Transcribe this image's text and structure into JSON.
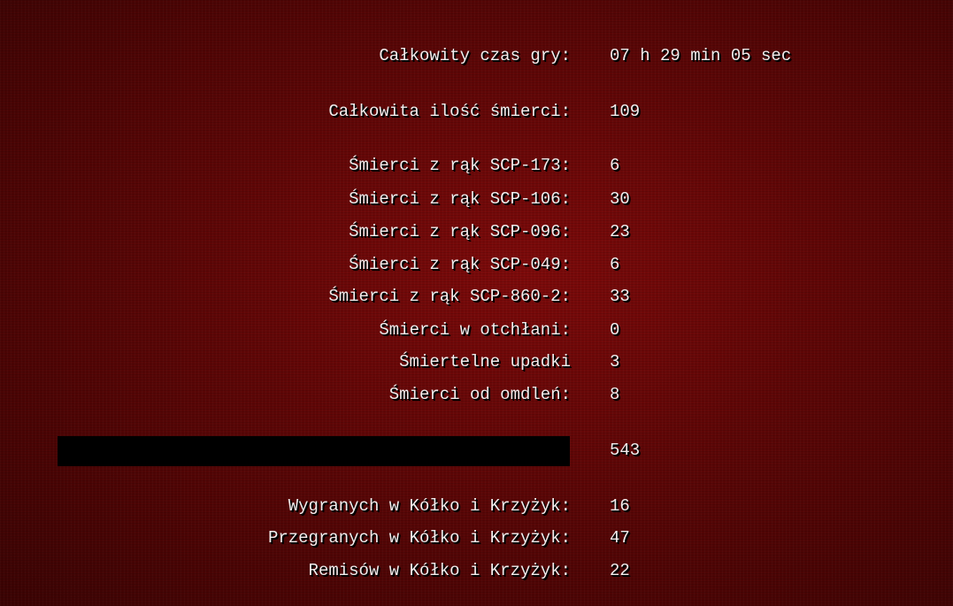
{
  "stats": {
    "total_time": {
      "label": "Całkowity czas gry:",
      "value": "07 h 29 min 05 sec"
    },
    "total_deaths": {
      "label": "Całkowita ilość śmierci:",
      "value": "109"
    },
    "deaths_173": {
      "label": "Śmierci z rąk SCP-173:",
      "value": "6"
    },
    "deaths_106": {
      "label": "Śmierci z rąk SCP-106:",
      "value": "30"
    },
    "deaths_096": {
      "label": "Śmierci z rąk SCP-096:",
      "value": "23"
    },
    "deaths_049": {
      "label": "Śmierci z rąk SCP-049:",
      "value": "6"
    },
    "deaths_860_2": {
      "label": "Śmierci z rąk SCP-860-2:",
      "value": "33"
    },
    "deaths_abyss": {
      "label": "Śmierci w otchłani:",
      "value": "0"
    },
    "fatal_falls": {
      "label": "Śmiertelne upadki",
      "value": "3"
    },
    "faint_deaths": {
      "label": "Śmierci od omdleń:",
      "value": "8"
    },
    "redacted": {
      "value": "543"
    },
    "ttt_wins": {
      "label": "Wygranych w Kółko i Krzyżyk:",
      "value": "16"
    },
    "ttt_losses": {
      "label": "Przegranych w Kółko i Krzyżyk:",
      "value": "47"
    },
    "ttt_draws": {
      "label": "Remisów w Kółko i Krzyżyk:",
      "value": "22"
    }
  },
  "colors": {
    "background": "#5c0606",
    "text": "#f2ecec",
    "redaction": "#000000"
  }
}
